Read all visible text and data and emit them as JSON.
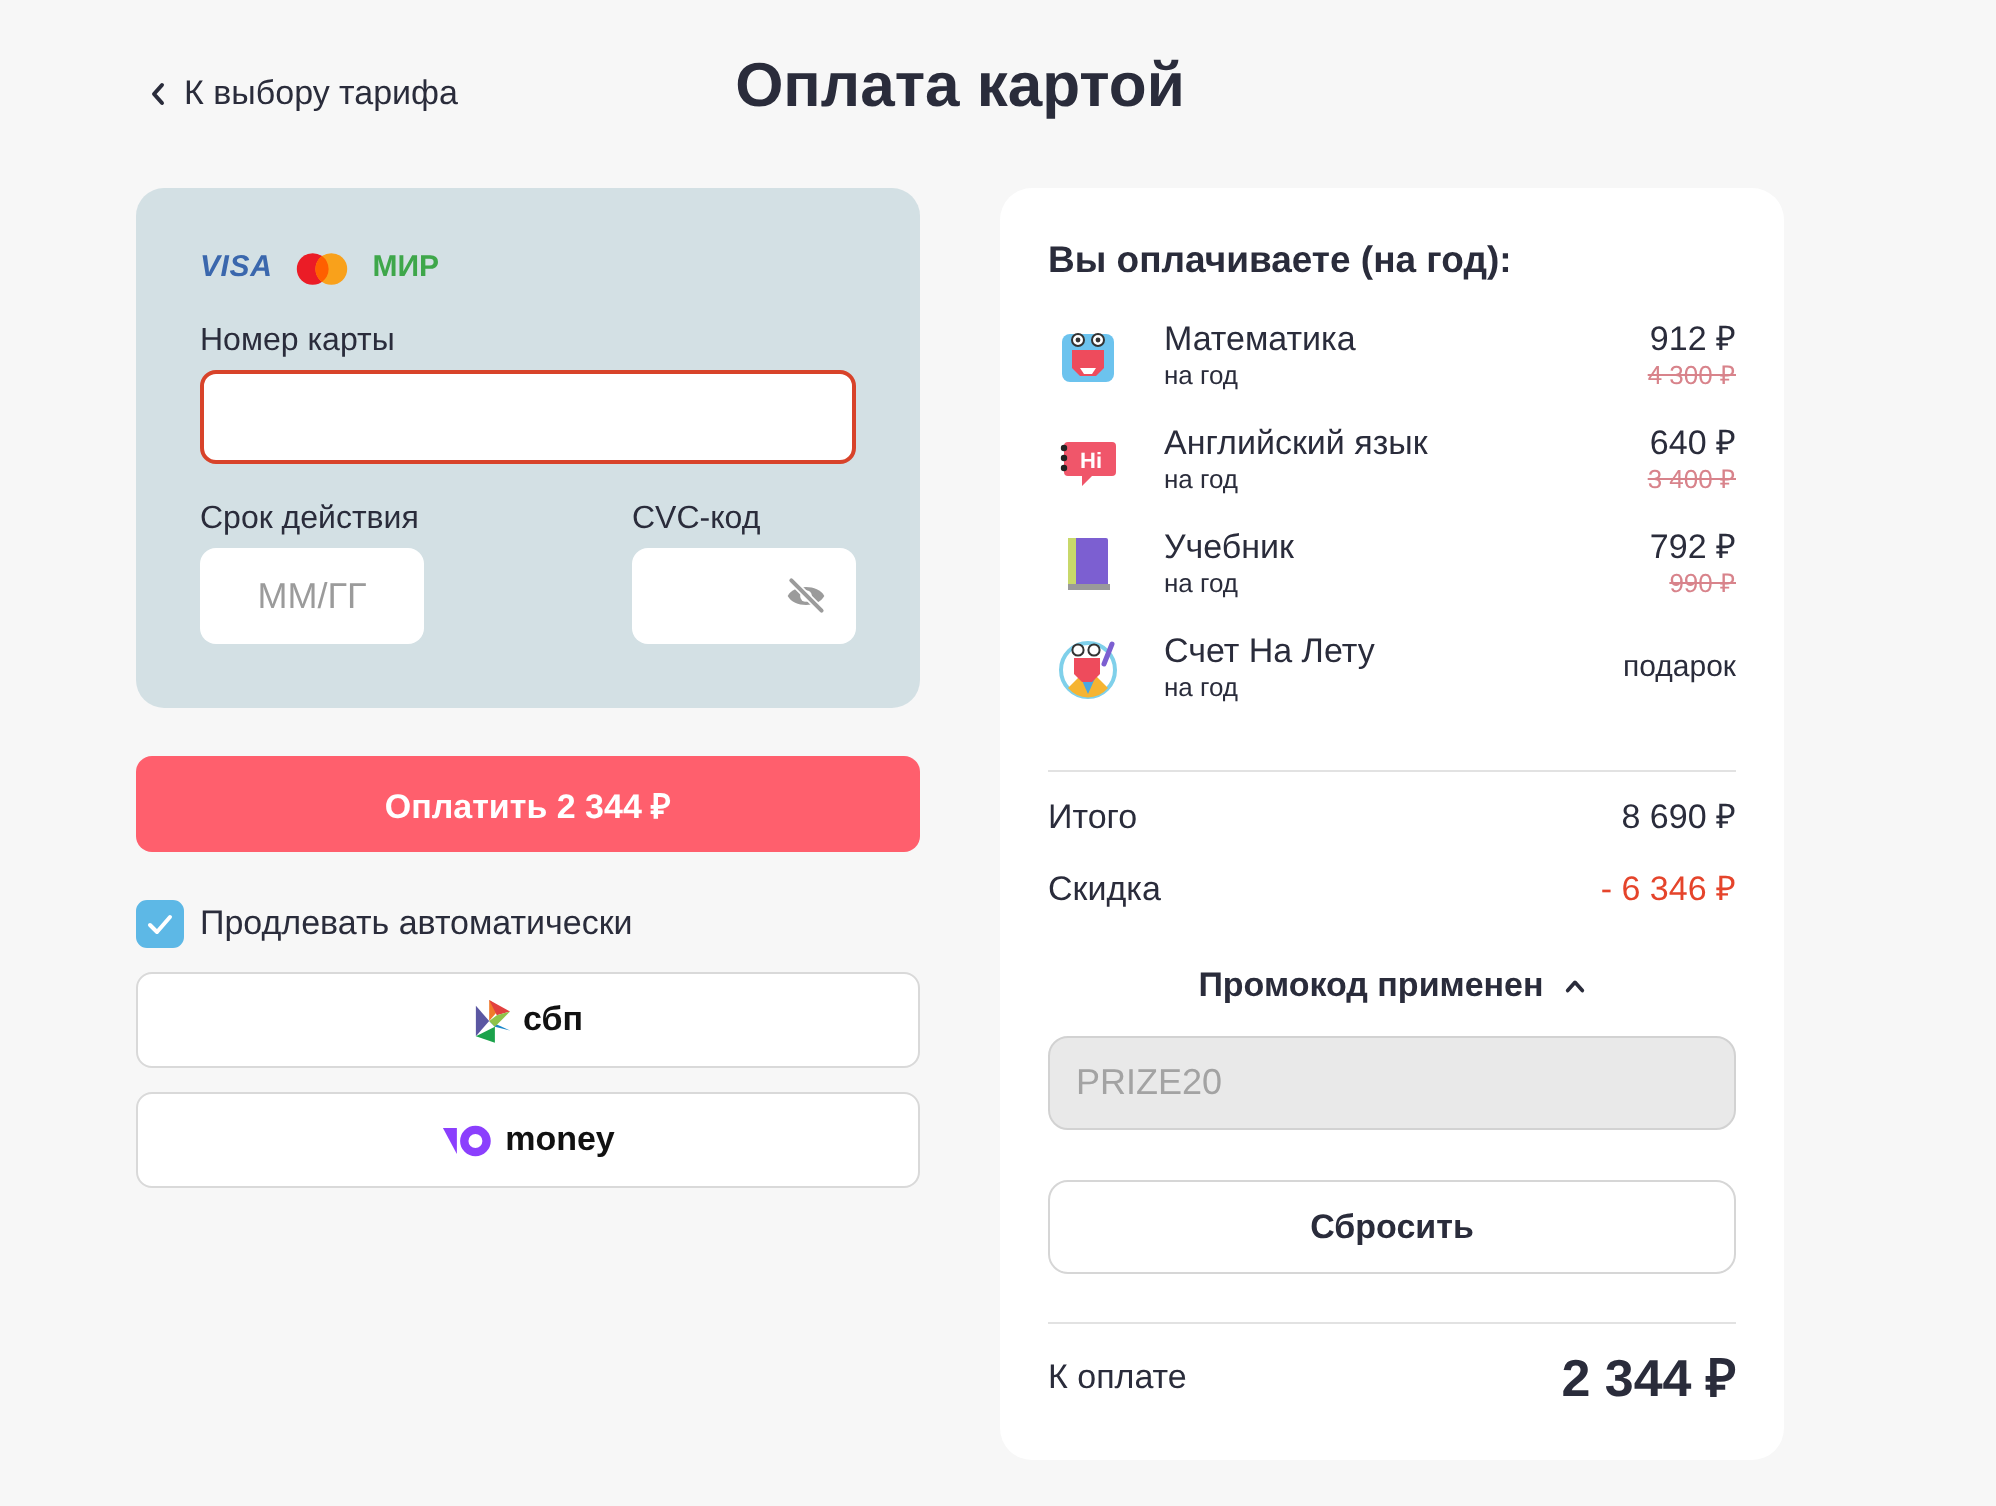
{
  "back_link": {
    "label": "К выбору тарифа"
  },
  "title": "Оплата картой",
  "card_form": {
    "brands": [
      {
        "kind": "visa",
        "label": "VISA"
      },
      {
        "kind": "mastercard"
      },
      {
        "kind": "mir",
        "label": "МИР"
      }
    ],
    "fields": [
      {
        "kind": "card_number",
        "label": "Номер карты",
        "error": true
      },
      {
        "kind": "expiry",
        "label": "Срок действия",
        "placeholder": "ММ/ГГ",
        "error": false
      },
      {
        "kind": "cvc",
        "label": "CVC-код",
        "error": false
      }
    ]
  },
  "pay_button": {
    "label": "Оплатить 2 344 ₽"
  },
  "auto_renew": {
    "label": "Продлевать автоматически",
    "checked": true
  },
  "payment_methods": [
    {
      "kind": "sbp",
      "label": "сбп"
    },
    {
      "kind": "yoomoney",
      "label": "money"
    }
  ],
  "summary": {
    "heading": "Вы оплачиваете (на год):",
    "items": [
      {
        "kind": "math",
        "name": "Математика",
        "period": "на год",
        "price": "912 ₽",
        "old_price": "4 300 ₽"
      },
      {
        "kind": "english",
        "icon_text": "Hi",
        "name": "Английский язык",
        "period": "на год",
        "price": "640 ₽",
        "old_price": "3 400 ₽"
      },
      {
        "kind": "textbook",
        "name": "Учебник",
        "period": "на год",
        "price": "792 ₽",
        "old_price": "990 ₽"
      },
      {
        "kind": "mental_math",
        "name": "Счет На Лету",
        "period": "на год",
        "price": "подарок"
      }
    ],
    "total": {
      "label": "Итого",
      "value": "8 690 ₽"
    },
    "discount": {
      "label": "Скидка",
      "value": "- 6 346 ₽"
    },
    "promo": {
      "label": "Промокод применен",
      "expanded": true,
      "code": "PRIZE20",
      "disabled": true
    },
    "reset_button": {
      "label": "Сбросить"
    },
    "due": {
      "label": "К оплате",
      "value": "2 344 ₽"
    }
  }
}
